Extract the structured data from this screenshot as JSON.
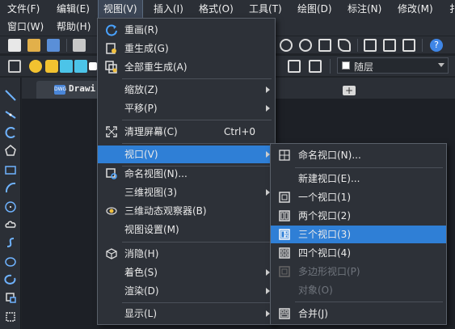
{
  "menubar": {
    "items": [
      {
        "label": "文件(F)"
      },
      {
        "label": "编辑(E)"
      },
      {
        "label": "视图(V)"
      },
      {
        "label": "插入(I)"
      },
      {
        "label": "格式(O)"
      },
      {
        "label": "工具(T)"
      },
      {
        "label": "绘图(D)"
      },
      {
        "label": "标注(N)"
      },
      {
        "label": "修改(M)"
      },
      {
        "label": "扌"
      }
    ],
    "row2": [
      {
        "label": "窗口(W)"
      },
      {
        "label": "帮助(H)"
      }
    ]
  },
  "layer_combo": {
    "value": "随层"
  },
  "tab": {
    "title": "Drawi",
    "icon_text": "DWG"
  },
  "view_menu": {
    "items": [
      {
        "label": "重画(R)",
        "icon": "redraw-icon"
      },
      {
        "label": "重生成(G)",
        "icon": "regen-icon"
      },
      {
        "label": "全部重生成(A)",
        "icon": "regen-all-icon"
      },
      {
        "label": "缩放(Z)",
        "submenu": true
      },
      {
        "label": "平移(P)",
        "submenu": true
      },
      {
        "label": "清理屏幕(C)",
        "shortcut": "Ctrl+0",
        "icon": "clean-screen-icon"
      },
      {
        "label": "视口(V)",
        "submenu": true,
        "highlighted": true
      },
      {
        "label": "命名视图(N)...",
        "icon": "named-view-icon"
      },
      {
        "label": "三维视图(3)",
        "submenu": true
      },
      {
        "label": "三维动态观察器(B)",
        "icon": "orbit-icon"
      },
      {
        "label": "视图设置(M)"
      },
      {
        "label": "消隐(H)",
        "icon": "hide-icon"
      },
      {
        "label": "着色(S)",
        "submenu": true
      },
      {
        "label": "渲染(D)",
        "submenu": true
      },
      {
        "label": "显示(L)",
        "submenu": true
      }
    ]
  },
  "viewport_submenu": {
    "items": [
      {
        "label": "命名视口(N)...",
        "icon": "named-viewport-icon"
      },
      {
        "label": "新建视口(E)..."
      },
      {
        "label": "一个视口(1)",
        "icon": "one-viewport-icon"
      },
      {
        "label": "两个视口(2)",
        "icon": "two-viewports-icon"
      },
      {
        "label": "三个视口(3)",
        "icon": "three-viewports-icon",
        "highlighted": true
      },
      {
        "label": "四个视口(4)",
        "icon": "four-viewports-icon"
      },
      {
        "label": "多边形视口(P)",
        "icon": "polygon-viewport-icon",
        "disabled": true
      },
      {
        "label": "对象(O)",
        "disabled": true
      },
      {
        "label": "合并(J)",
        "icon": "join-viewports-icon"
      }
    ]
  },
  "colors": {
    "accent": "#2f7fd6",
    "menu_bg": "#2d3138",
    "app_bg": "#2b2f36"
  }
}
